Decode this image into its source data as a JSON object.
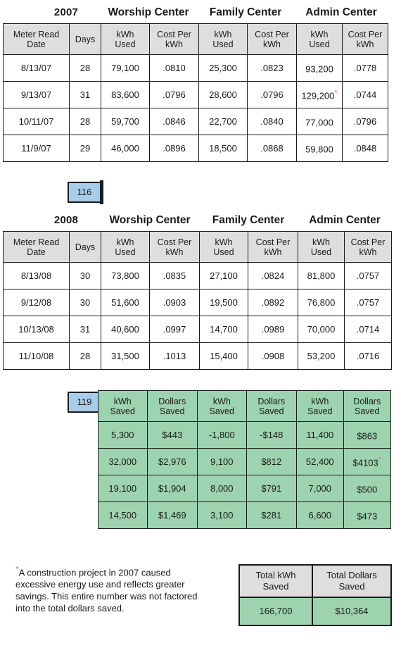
{
  "colors": {
    "header_gray": "#dedede",
    "savings_green": "#9dd3ae",
    "days_blue": "#a8cdea",
    "footnote_star": "#e8677a",
    "grid_black": "#1a1a1a"
  },
  "section_2007": {
    "year": "2007",
    "centers": [
      "Worship Center",
      "Family Center",
      "Admin Center"
    ],
    "columns": [
      "Meter Read Date",
      "Days",
      "kWh Used",
      "Cost Per kWh",
      "kWh Used",
      "Cost Per kWh",
      "kWh Used",
      "Cost Per kWh"
    ],
    "column_lines": {
      "date_l1": "Meter Read",
      "date_l2": "Date",
      "days": "Days",
      "kwh_l1": "kWh",
      "kwh_l2": "Used",
      "cost_l1": "Cost Per",
      "cost_l2": "kWh"
    },
    "rows": [
      {
        "date": "8/13/07",
        "days": "28",
        "w_kwh": "79,100",
        "w_cost": ".0810",
        "f_kwh": "25,300",
        "f_cost": ".0823",
        "a_kwh": "93,200",
        "a_kwh_star": "",
        "a_cost": ".0778"
      },
      {
        "date": "9/13/07",
        "days": "31",
        "w_kwh": "83,600",
        "w_cost": ".0796",
        "f_kwh": "28,600",
        "f_cost": ".0796",
        "a_kwh": "129,200",
        "a_kwh_star": "*",
        "a_cost": ".0744"
      },
      {
        "date": "10/11/07",
        "days": "28",
        "w_kwh": "59,700",
        "w_cost": ".0846",
        "f_kwh": "22,700",
        "f_cost": ".0840",
        "a_kwh": "77,000",
        "a_kwh_star": "",
        "a_cost": ".0796"
      },
      {
        "date": "11/9/07",
        "days": "29",
        "w_kwh": "46,000",
        "w_cost": ".0896",
        "f_kwh": "18,500",
        "f_cost": ".0868",
        "a_kwh": "59,800",
        "a_kwh_star": "",
        "a_cost": ".0848"
      }
    ],
    "days_total": "116"
  },
  "section_2008": {
    "year": "2008",
    "centers": [
      "Worship Center",
      "Family Center",
      "Admin Center"
    ],
    "columns": [
      "Meter Read Date",
      "Days",
      "kWh Used",
      "Cost Per kWh",
      "kWh Used",
      "Cost Per kWh",
      "kWh Used",
      "Cost Per kWh"
    ],
    "column_lines": {
      "date_l1": "Meter Read",
      "date_l2": "Date",
      "days": "Days",
      "kwh_l1": "kWh",
      "kwh_l2": "Used",
      "cost_l1": "Cost Per",
      "cost_l2": "kWh"
    },
    "rows": [
      {
        "date": "8/13/08",
        "days": "30",
        "w_kwh": "73,800",
        "w_cost": ".0835",
        "f_kwh": "27,100",
        "f_cost": ".0824",
        "a_kwh": "81,800",
        "a_cost": ".0757"
      },
      {
        "date": "9/12/08",
        "days": "30",
        "w_kwh": "51,600",
        "w_cost": ".0903",
        "f_kwh": "19,500",
        "f_cost": ".0892",
        "a_kwh": "76,800",
        "a_cost": ".0757"
      },
      {
        "date": "10/13/08",
        "days": "31",
        "w_kwh": "40,600",
        "w_cost": ".0997",
        "f_kwh": "14,700",
        "f_cost": ".0989",
        "a_kwh": "70,000",
        "a_cost": ".0714"
      },
      {
        "date": "11/10/08",
        "days": "28",
        "w_kwh": "31,500",
        "w_cost": ".1013",
        "f_kwh": "15,400",
        "f_cost": ".0908",
        "a_kwh": "53,200",
        "a_cost": ".0716"
      }
    ],
    "days_total": "119"
  },
  "savings": {
    "header_lines": {
      "kwh_l1": "kWh",
      "kwh_l2": "Saved",
      "dollars_l1": "Dollars",
      "dollars_l2": "Saved"
    },
    "headers": [
      "kWh Saved",
      "Dollars Saved",
      "kWh Saved",
      "Dollars Saved",
      "kWh Saved",
      "Dollars Saved"
    ],
    "rows": [
      {
        "w_kwh": "5,300",
        "w_dol": "$443",
        "f_kwh": "-1,800",
        "f_dol": "-$148",
        "a_kwh": "11,400",
        "a_dol": "$863",
        "a_dol_star": ""
      },
      {
        "w_kwh": "32,000",
        "w_dol": "$2,976",
        "f_kwh": "9,100",
        "f_dol": "$812",
        "a_kwh": "52,400",
        "a_dol": "$4103",
        "a_dol_star": "*"
      },
      {
        "w_kwh": "19,100",
        "w_dol": "$1,904",
        "f_kwh": "8,000",
        "f_dol": "$791",
        "a_kwh": "7,000",
        "a_dol": "$500",
        "a_dol_star": ""
      },
      {
        "w_kwh": "14,500",
        "w_dol": "$1,469",
        "f_kwh": "3,100",
        "f_dol": "$281",
        "a_kwh": "6,600",
        "a_dol": "$473",
        "a_dol_star": ""
      }
    ]
  },
  "footnote": {
    "marker": "*",
    "text": "A construction project in 2007 caused excessive energy use and reflects greater savings. This entire number was not factored into the total dollars saved."
  },
  "totals": {
    "kwh_header_l1": "Total kWh",
    "kwh_header_l2": "Saved",
    "dollars_header_l1": "Total Dollars",
    "dollars_header_l2": "Saved",
    "kwh_value": "166,700",
    "dollars_value": "$10,364"
  }
}
